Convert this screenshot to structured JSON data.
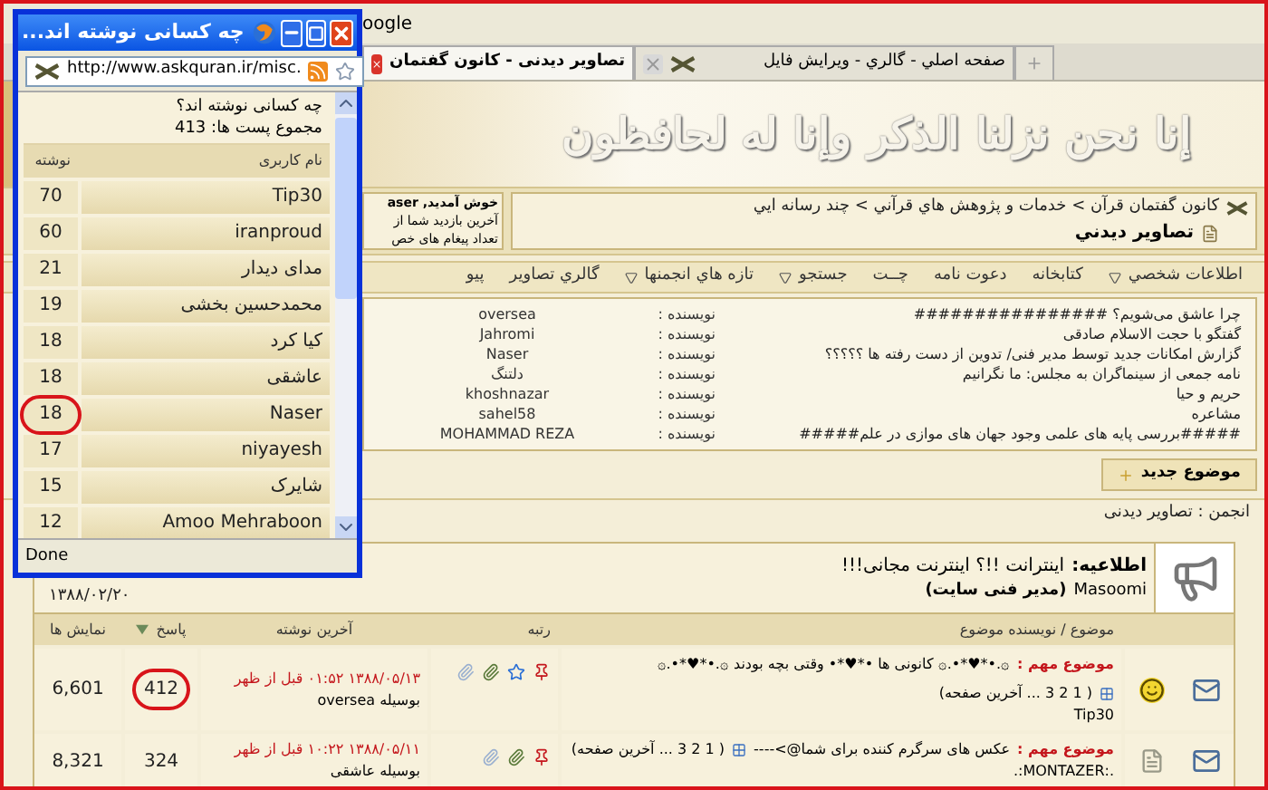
{
  "browser": {
    "search_text": "oogle",
    "tabs": [
      {
        "title": "صفحه اصلي - گالري - ويرايش فايل",
        "selected": false
      },
      {
        "title": "تصاویر دیدنی - کانون گفتمان",
        "selected": true
      }
    ]
  },
  "banner": {
    "text": "إنا نحن نزلنا الذكر وإنا له لحافظون"
  },
  "welcome": [
    "خوش آمدید, aser",
    "آخرین بازدید شما از",
    "تعداد پیغام های خص"
  ],
  "breadcrumb": {
    "path": "کانون گفتمان قرآن > خدمات و پژوهش هاي قرآني > چند رسانه ايي",
    "current": "تصاوير ديدني"
  },
  "nav": [
    {
      "label": "اطلاعات شخصي",
      "dropdown": true
    },
    {
      "label": "کتابخانه",
      "dropdown": false
    },
    {
      "label": "دعوت نامه",
      "dropdown": false
    },
    {
      "label": "چــت",
      "dropdown": false
    },
    {
      "label": "جستجو",
      "dropdown": true
    },
    {
      "label": "تازه هاي انجمنها",
      "dropdown": true
    },
    {
      "label": "گالري تصاوير",
      "dropdown": false
    },
    {
      "label": "پیو",
      "dropdown": false
    }
  ],
  "ticker": [
    {
      "title": "چرا عاشق می‌شویم؟ ################",
      "author_label": "نویسنده :",
      "author": "oversea"
    },
    {
      "title": "گفتگو با حجت الاسلام صادقی",
      "author_label": "نویسنده :",
      "author": "Jahromi"
    },
    {
      "title": "گزارش امکانات جدید توسط مدیر فنی/ تدوین از دست رفته ها ؟؟؟؟؟",
      "author_label": "نویسنده :",
      "author": "Naser"
    },
    {
      "title": "نامه جمعی از سینماگران به مجلس: ما نگرانیم",
      "author_label": "نویسنده :",
      "author": "دلتنگ"
    },
    {
      "title": "حریم و حیا",
      "author_label": "نویسنده :",
      "author": "khoshnazar"
    },
    {
      "title": "مشاعره",
      "author_label": "نویسنده :",
      "author": "sahel58"
    },
    {
      "title": "#####بررسی پایه های علمی وجود جهان های موازی در علم#####",
      "author_label": "نویسنده :",
      "author": "MOHAMMAD REZA"
    }
  ],
  "new_topic_button": "موضوع جدید",
  "forum_path": "انجمن : تصاویر دیدنی",
  "announcement": {
    "label": "اطلاعیه:",
    "title": "اینترانت !!؟ اینترنت مجانی!!!",
    "author": "Masoomi",
    "role": "(مدیر فنی سایت)",
    "date": "۱۳۸۸/۰۲/۲۰"
  },
  "table": {
    "columns": [
      "موضوع / نویسنده موضوع",
      "رتبه",
      "آخرین نوشته",
      "پاسخ",
      "نمایش ها"
    ],
    "rows": [
      {
        "prefix": "موضوع مهم :",
        "title": "۞.•*♥*•.۞ کانونی ها •*♥*• وقتی بچه بودند ۞.•*♥*•.۞",
        "pages": "( 1 2 3 ... آخرین صفحه)",
        "pages_on_new_line": true,
        "author": "Tip30",
        "date": "۱۳۸۸/۰۵/۱۳ ۰۱:۵۲ قبل از ظهر",
        "by": "بوسیله oversea",
        "replies": "412",
        "circled": true,
        "views": "6,601"
      },
      {
        "prefix": "موضوع مهم :",
        "title": "عکس های سرگرم کننده برای شما@>----",
        "pages": "( 1 2 3 ... آخرین صفحه)",
        "pages_on_new_line": false,
        "author": ".:MONTAZER:.",
        "date": "۱۳۸۸/۰۵/۱۱ ۱۰:۲۲ قبل از ظهر",
        "by": "بوسیله عاشقی",
        "replies": "324",
        "circled": false,
        "views": "8,321"
      }
    ]
  },
  "popup": {
    "title": "چه کسانی نوشته اند...",
    "address": "http://www.askquran.ir/misc.",
    "heading": "چه کسانی نوشته اند؟",
    "total": "مجموع پست ها: 413",
    "columns": [
      "نام کاربری",
      "نوشته"
    ],
    "rows": [
      {
        "user": "Tip30",
        "count": "70",
        "circled": false
      },
      {
        "user": "iranproud",
        "count": "60",
        "circled": false
      },
      {
        "user": "مدای دیدار",
        "count": "21",
        "circled": false
      },
      {
        "user": "محمدحسین بخشی",
        "count": "19",
        "circled": false
      },
      {
        "user": "کیا کرد",
        "count": "18",
        "circled": false
      },
      {
        "user": "عاشقی",
        "count": "18",
        "circled": false
      },
      {
        "user": "Naser",
        "count": "18",
        "circled": true
      },
      {
        "user": "niyayesh",
        "count": "17",
        "circled": false
      },
      {
        "user": "شایرک",
        "count": "15",
        "circled": false
      },
      {
        "user": "Amoo Mehraboon",
        "count": "12",
        "circled": false
      }
    ],
    "status": "Done"
  }
}
